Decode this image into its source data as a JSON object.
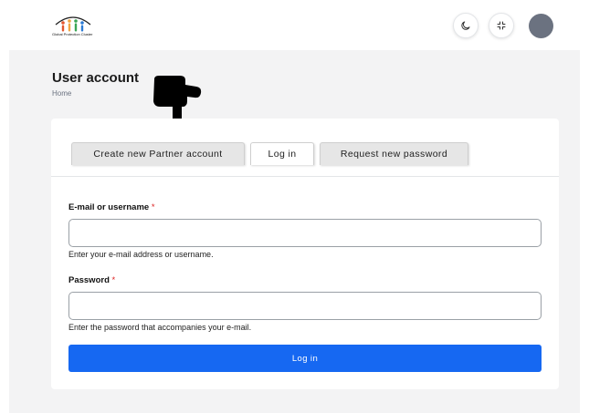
{
  "header": {
    "logo_text": "Global Protection Cluster",
    "logo_icon": "people-logo-icon",
    "dark_mode_icon": "moon-icon",
    "collapse_icon": "collapse-icon",
    "avatar_color": "#6b7280"
  },
  "page": {
    "title": "User account",
    "breadcrumb": "Home"
  },
  "tabs": [
    {
      "label": "Create new Partner account",
      "active": false
    },
    {
      "label": "Log in",
      "active": true
    },
    {
      "label": "Request new password",
      "active": false
    }
  ],
  "form": {
    "username": {
      "label": "E-mail or username",
      "required_mark": "*",
      "value": "",
      "help": "Enter your e-mail address or username."
    },
    "password": {
      "label": "Password",
      "required_mark": "*",
      "value": "",
      "help": "Enter the password that accompanies your e-mail."
    },
    "submit_label": "Log in"
  },
  "colors": {
    "accent": "#1668f2",
    "required": "#dd2222",
    "background": "#f3f3f4"
  }
}
